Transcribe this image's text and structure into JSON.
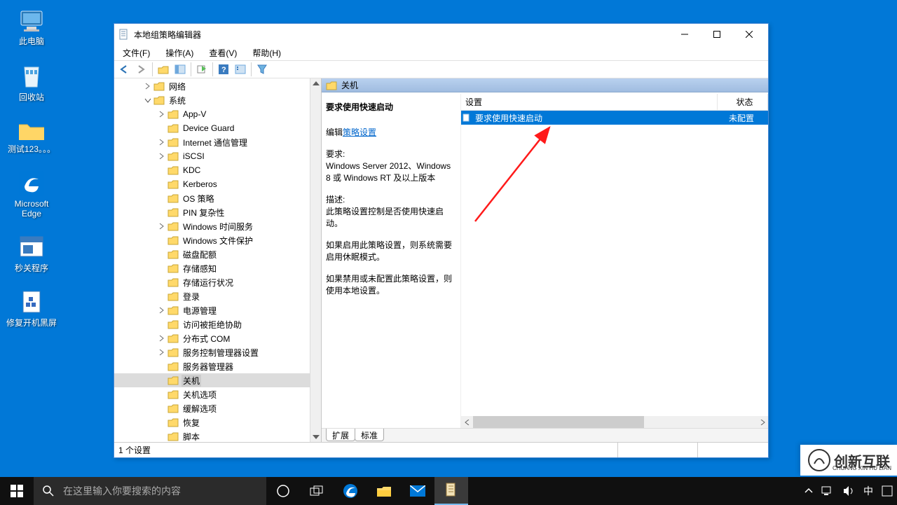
{
  "desktop": {
    "icons": [
      {
        "label": "此电脑",
        "svg": "pc"
      },
      {
        "label": "回收站",
        "svg": "bin"
      },
      {
        "label": "测试123。。。",
        "svg": "folder"
      },
      {
        "label": "Microsoft Edge",
        "svg": "edge"
      },
      {
        "label": "秒关程序",
        "svg": "app"
      },
      {
        "label": "修复开机黑屏",
        "svg": "fix"
      }
    ]
  },
  "window": {
    "title": "本地组策略编辑器",
    "menus": {
      "file": "文件(F)",
      "action": "操作(A)",
      "view": "查看(V)",
      "help": "帮助(H)"
    }
  },
  "tree": {
    "items": [
      {
        "label": "网络",
        "indent": 42,
        "exp": "closed"
      },
      {
        "label": "系统",
        "indent": 42,
        "exp": "open"
      },
      {
        "label": "App-V",
        "indent": 62,
        "exp": "closed"
      },
      {
        "label": "Device Guard",
        "indent": 62,
        "exp": "none"
      },
      {
        "label": "Internet 通信管理",
        "indent": 62,
        "exp": "closed"
      },
      {
        "label": "iSCSI",
        "indent": 62,
        "exp": "closed"
      },
      {
        "label": "KDC",
        "indent": 62,
        "exp": "none"
      },
      {
        "label": "Kerberos",
        "indent": 62,
        "exp": "none"
      },
      {
        "label": "OS 策略",
        "indent": 62,
        "exp": "none"
      },
      {
        "label": "PIN 复杂性",
        "indent": 62,
        "exp": "none"
      },
      {
        "label": "Windows 时间服务",
        "indent": 62,
        "exp": "closed"
      },
      {
        "label": "Windows 文件保护",
        "indent": 62,
        "exp": "none"
      },
      {
        "label": "磁盘配额",
        "indent": 62,
        "exp": "none"
      },
      {
        "label": "存储感知",
        "indent": 62,
        "exp": "none"
      },
      {
        "label": "存储运行状况",
        "indent": 62,
        "exp": "none"
      },
      {
        "label": "登录",
        "indent": 62,
        "exp": "none"
      },
      {
        "label": "电源管理",
        "indent": 62,
        "exp": "closed"
      },
      {
        "label": "访问被拒绝协助",
        "indent": 62,
        "exp": "none"
      },
      {
        "label": "分布式 COM",
        "indent": 62,
        "exp": "closed"
      },
      {
        "label": "服务控制管理器设置",
        "indent": 62,
        "exp": "closed"
      },
      {
        "label": "服务器管理器",
        "indent": 62,
        "exp": "none"
      },
      {
        "label": "关机",
        "indent": 62,
        "exp": "none",
        "selected": true
      },
      {
        "label": "关机选项",
        "indent": 62,
        "exp": "none"
      },
      {
        "label": "缓解选项",
        "indent": 62,
        "exp": "none"
      },
      {
        "label": "恢复",
        "indent": 62,
        "exp": "none"
      },
      {
        "label": "脚本",
        "indent": 62,
        "exp": "none"
      }
    ]
  },
  "right": {
    "header": "关机",
    "detail": {
      "title": "要求使用快速启动",
      "edit_prefix": "编辑",
      "edit_link": "策略设置",
      "req_label": "要求:",
      "req_text": "Windows Server 2012、Windows 8 或 Windows RT 及以上版本",
      "desc_label": "描述:",
      "desc_text": "此策略设置控制是否使用快速启动。",
      "p1": "如果启用此策略设置，则系统需要启用休眠模式。",
      "p2": "如果禁用或未配置此策略设置，则使用本地设置。"
    },
    "columns": {
      "setting": "设置",
      "state": "状态"
    },
    "row": {
      "text": "要求使用快速启动",
      "state": "未配置"
    },
    "tabs": {
      "ext": "扩展",
      "std": "标准"
    }
  },
  "status": {
    "text": "1 个设置"
  },
  "taskbar": {
    "search_placeholder": "在这里输入你要搜索的内容",
    "ime": "中"
  },
  "watermark": {
    "brand": "创新互联",
    "sub": "CHUANG XIN HU LIAN"
  }
}
